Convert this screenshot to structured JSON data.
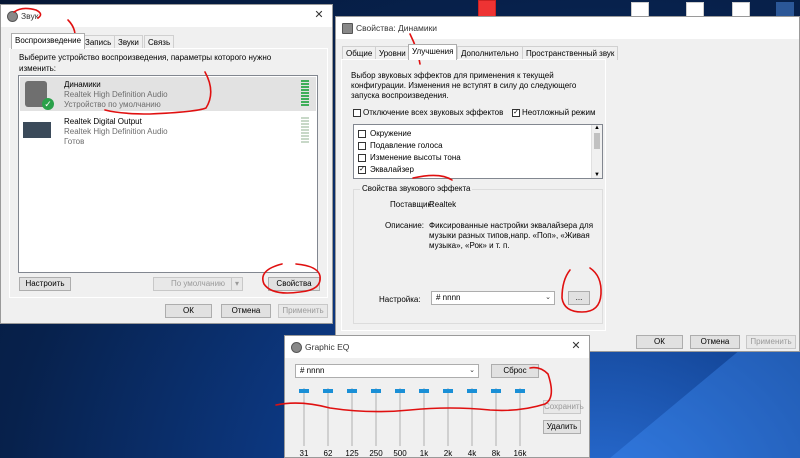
{
  "sound": {
    "title": "Звук",
    "tabs": [
      "Воспроизведение",
      "Запись",
      "Звуки",
      "Связь"
    ],
    "instruction": "Выберите устройство воспроизведения, параметры которого нужно изменить:",
    "devices": [
      {
        "name": "Динамики",
        "driver": "Realtek High Definition Audio",
        "status": "Устройство по умолчанию",
        "selected": true
      },
      {
        "name": "Realtek Digital Output",
        "driver": "Realtek High Definition Audio",
        "status": "Готов",
        "selected": false
      }
    ],
    "configure_label": "Настроить",
    "default_label": "По умолчанию",
    "properties_label": "Свойства",
    "ok_label": "ОК",
    "cancel_label": "Отмена",
    "apply_label": "Применить"
  },
  "props": {
    "title": "Свойства: Динамики",
    "tabs": [
      "Общие",
      "Уровни",
      "Улучшения",
      "Дополнительно",
      "Пространственный звук"
    ],
    "description": "Выбор звуковых эффектов для применения к текущей конфигурации. Изменения не вступят в силу до следующего запуска воспроизведения.",
    "disable_all_label": "Отключение всех звуковых эффектов",
    "immediate_label": "Неотложный режим",
    "effects": [
      {
        "label": "Окружение",
        "checked": false
      },
      {
        "label": "Подавление голоса",
        "checked": false
      },
      {
        "label": "Изменение высоты тона",
        "checked": false
      },
      {
        "label": "Эквалайзер",
        "checked": true
      }
    ],
    "effect_props_title": "Свойства звукового эффекта",
    "provider_label": "Поставщик:",
    "provider_value": "Realtek",
    "desc_label": "Описание:",
    "desc_value": "Фиксированные настройки эквалайзера для музыки разных типов,напр. «Поп», «Живая музыка», «Рок» и т. п.",
    "setting_label": "Настройка:",
    "setting_value": "# nnnn",
    "more_label": "...",
    "ok_label": "ОК",
    "cancel_label": "Отмена",
    "apply_label": "Применить"
  },
  "eq": {
    "title": "Graphic EQ",
    "preset_value": "# nnnn",
    "reset_label": "Сброс",
    "save_label": "Сохранить",
    "delete_label": "Удалить",
    "bands": [
      "31",
      "62",
      "125",
      "250",
      "500",
      "1k",
      "2k",
      "4k",
      "8k",
      "16k"
    ]
  },
  "colors": {
    "accent": "#1a8fd6",
    "annotation": "#e01010",
    "desktop": "#0d3a86"
  }
}
